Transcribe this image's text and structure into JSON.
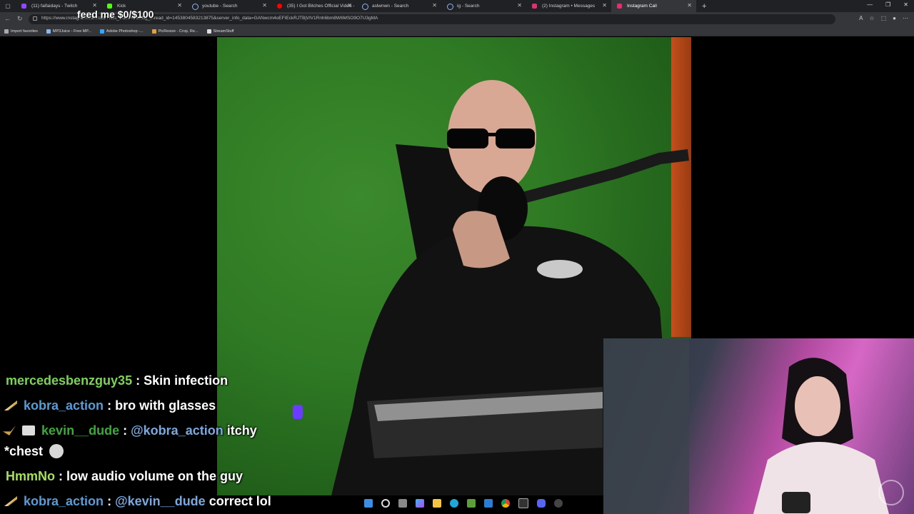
{
  "tabs": [
    {
      "label": "(11) faifaidays - Twitch",
      "color": "#9146ff"
    },
    {
      "label": "Kick",
      "color": "#53fc18"
    },
    {
      "label": "youtube - Search",
      "color": "#8ab4f8"
    },
    {
      "label": "(35) I Got Bitches Official Video -",
      "color": "#ff0000"
    },
    {
      "label": "aslwnwn - Search",
      "color": "#8ab4f8"
    },
    {
      "label": "ig - Search",
      "color": "#8ab4f8"
    },
    {
      "label": "(2) Instagram • Messages",
      "color": "#e1306c"
    },
    {
      "label": "Instagram Call",
      "color": "#e1306c"
    }
  ],
  "address_bar": {
    "url": "https://www.instagram.com/call/?has_video=true&ig_thread_id=1453804583213875&server_info_data=GANwcm4oEFIEckRJTBjVlV1Rnh6bm8W6MSO9O7U3gMA"
  },
  "bookmarks": [
    "Import favorites",
    "MP3Juice - Free MP...",
    "Adobe Photoshop -...",
    "PicResize - Crop, Re...",
    "StreamStuff"
  ],
  "overlay": {
    "donation_goal": "feed me $0/$100"
  },
  "chat": [
    {
      "user": "mercedesbenzguy35",
      "user_color": "#7dd35a",
      "sep": ":",
      "text": "Skin infection",
      "mention": ""
    },
    {
      "user": "kobra_action",
      "user_color": "#5b9bd5",
      "sep": ":",
      "text": "bro with glasses",
      "mention": ""
    },
    {
      "user": "kevin__dude",
      "user_color": "#3fa83a",
      "sep": ":",
      "mention": "@kobra_action",
      "text": "itchy"
    },
    {
      "user": "",
      "user_color": "#ffffff",
      "sep": "",
      "mention": "",
      "text": "*chest"
    },
    {
      "user": "HmmNo",
      "user_color": "#a6e05a",
      "sep": ":",
      "text": "low audio volume on the guy",
      "mention": ""
    },
    {
      "user": "kobra_action",
      "user_color": "#5b9bd5",
      "sep": ":",
      "mention": "@kevin__dude",
      "text": "correct lol"
    }
  ]
}
